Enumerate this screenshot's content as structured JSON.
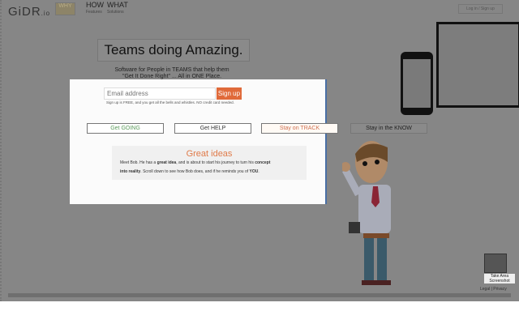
{
  "header": {
    "logo": "GiDR",
    "logo_suffix": ".io",
    "why": "WHY",
    "nav": [
      {
        "label": "HOW",
        "sub": "Features"
      },
      {
        "label": "WHAT",
        "sub": "Solutions"
      }
    ],
    "top_button": "Log in / Sign up"
  },
  "hero": {
    "title": "Teams doing Amazing.",
    "subtitle_line1": "Software for People in TEAMS that help them",
    "subtitle_line2": "\"Get It Done Right\" ... All in ONE Place."
  },
  "signup": {
    "placeholder": "Email address",
    "button": "Sign up",
    "note": "Sign up is FREE, and you get all the bells and whistles. NO credit card needed."
  },
  "tabs": [
    "Get GOING",
    "Get HELP",
    "Stay on TRACK",
    "Stay in the KNOW"
  ],
  "ideas": {
    "title": "Great ideas",
    "t1": "Meet Bob. He has a ",
    "b1": "great idea",
    "t2": ", and is about to start his journey to turn his ",
    "b2": "concept",
    "b3": "into reality",
    "t3": ". Scroll down to see how Bob does, and if he reminds you of ",
    "b4": "YOU",
    "t4": "."
  },
  "footer": {
    "screenshot_label": "Take Area Screenshot",
    "legal": "Legal | Privacy"
  }
}
